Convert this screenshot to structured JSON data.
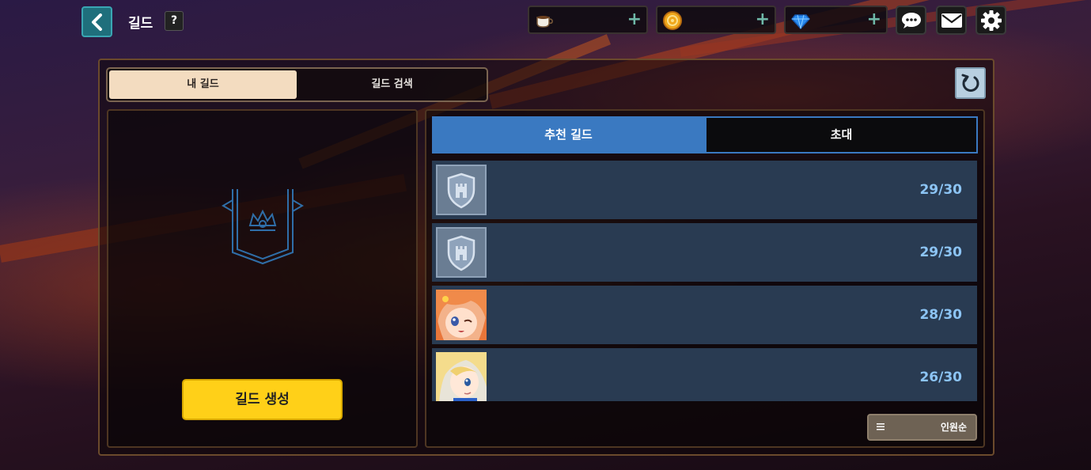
{
  "header": {
    "title": "길드",
    "help_label": "?"
  },
  "currencies": [
    {
      "icon": "coffee-cup-icon",
      "value": "",
      "add_label": "+"
    },
    {
      "icon": "gold-coin-icon",
      "value": "",
      "add_label": "+"
    },
    {
      "icon": "blue-gem-icon",
      "value": "",
      "add_label": "+"
    }
  ],
  "top_icons": [
    "chat-icon",
    "mail-icon",
    "settings-gear-icon"
  ],
  "tabs": {
    "my_guild": "내 길드",
    "guild_search": "길드 검색"
  },
  "left_panel": {
    "emblem_icon": "guild-banner-crown-icon",
    "create_button": "길드 생성"
  },
  "subtabs": {
    "recommended": "추천 길드",
    "invite": "초대"
  },
  "guilds": [
    {
      "icon": "castle-shield-icon",
      "name": "",
      "members": "29/30"
    },
    {
      "icon": "castle-shield-icon",
      "name": "",
      "members": "29/30"
    },
    {
      "icon": "orange-hair-character-portrait",
      "name": "",
      "members": "28/30"
    },
    {
      "icon": "blonde-hair-character-portrait",
      "name": "",
      "members": "26/30"
    }
  ],
  "sort": {
    "icon": "list-lines-icon",
    "label": "인원순"
  },
  "colors": {
    "accent_blue": "#3a79c1",
    "create_button_yellow": "#ffd018",
    "member_count_blue": "#8cc4f4",
    "row_bg": "#293b52"
  }
}
